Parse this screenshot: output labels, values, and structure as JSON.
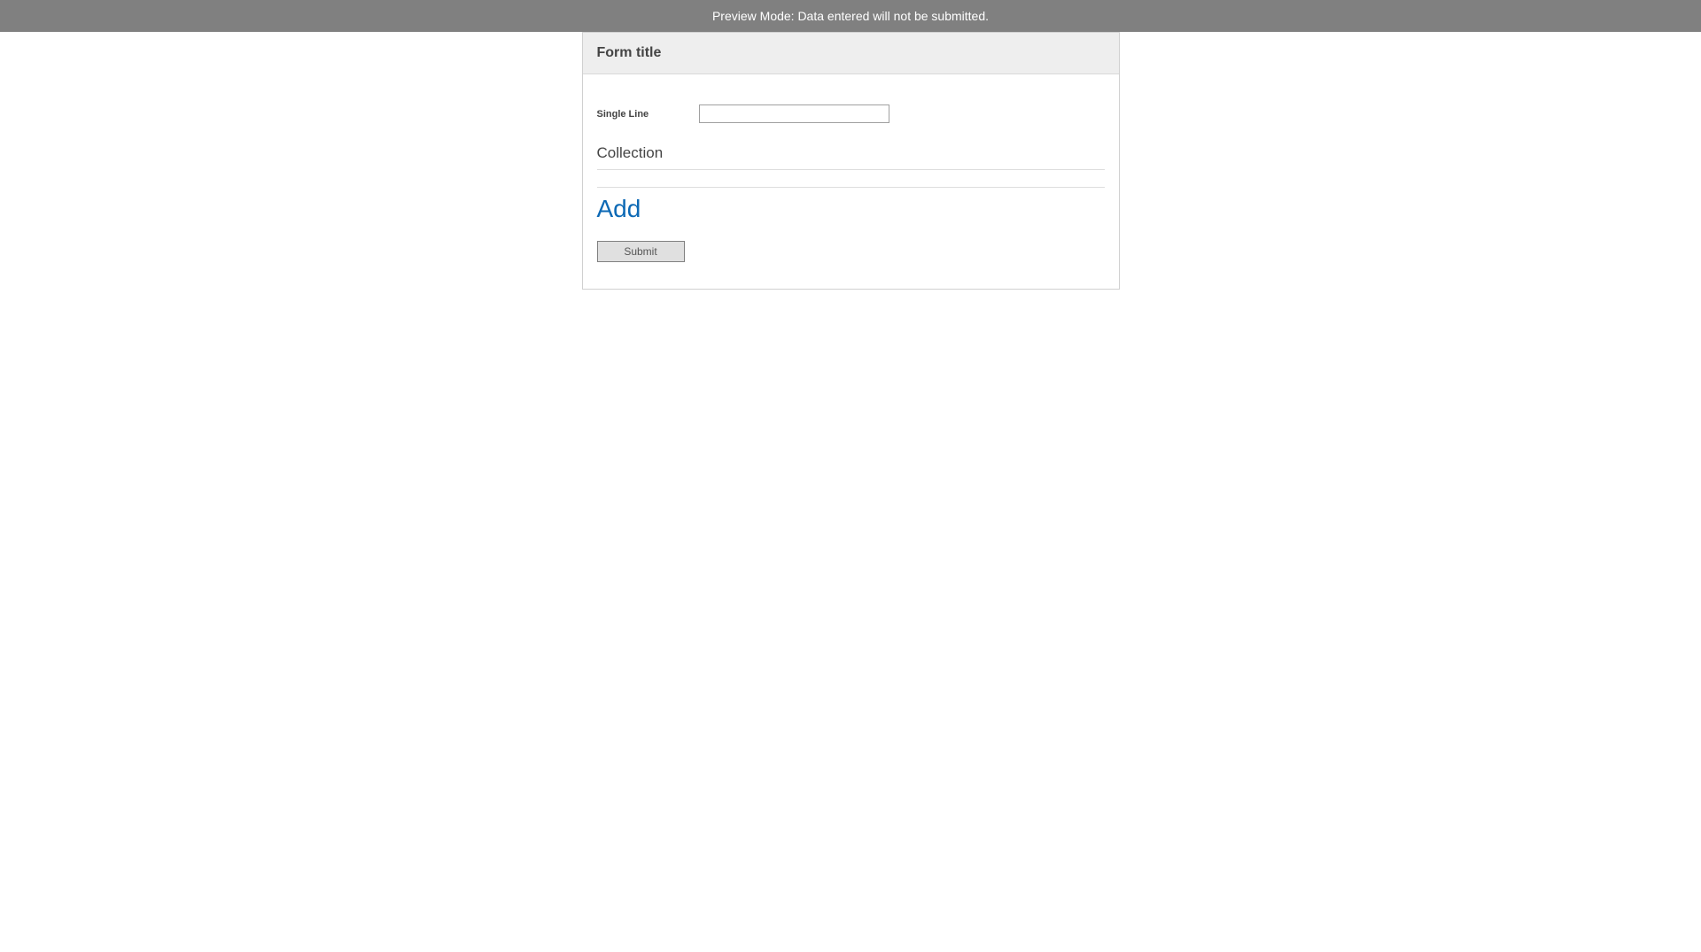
{
  "banner": {
    "text": "Preview Mode: Data entered will not be submitted."
  },
  "form": {
    "title": "Form title",
    "fields": {
      "single_line": {
        "label": "Single Line",
        "value": ""
      },
      "collection": {
        "heading": "Collection",
        "add_label": "Add"
      }
    },
    "submit_label": "Submit"
  }
}
